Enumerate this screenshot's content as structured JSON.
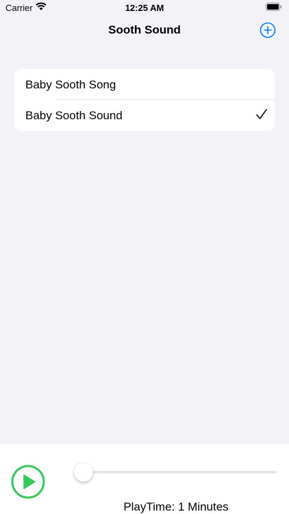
{
  "status_bar": {
    "carrier": "Carrier",
    "time": "12:25 AM"
  },
  "nav": {
    "title": "Sooth Sound",
    "add_icon": "plus-circle-icon"
  },
  "sounds": {
    "items": [
      {
        "label": "Baby Sooth Song",
        "selected": false
      },
      {
        "label": "Baby Sooth Sound",
        "selected": true
      }
    ]
  },
  "player": {
    "play_icon": "play-circle-icon",
    "slider_value": 0,
    "playtime": "PlayTime: 1 Minutes"
  },
  "colors": {
    "accent": "#007aff",
    "play": "#34c759",
    "background": "#f2f2f7"
  }
}
